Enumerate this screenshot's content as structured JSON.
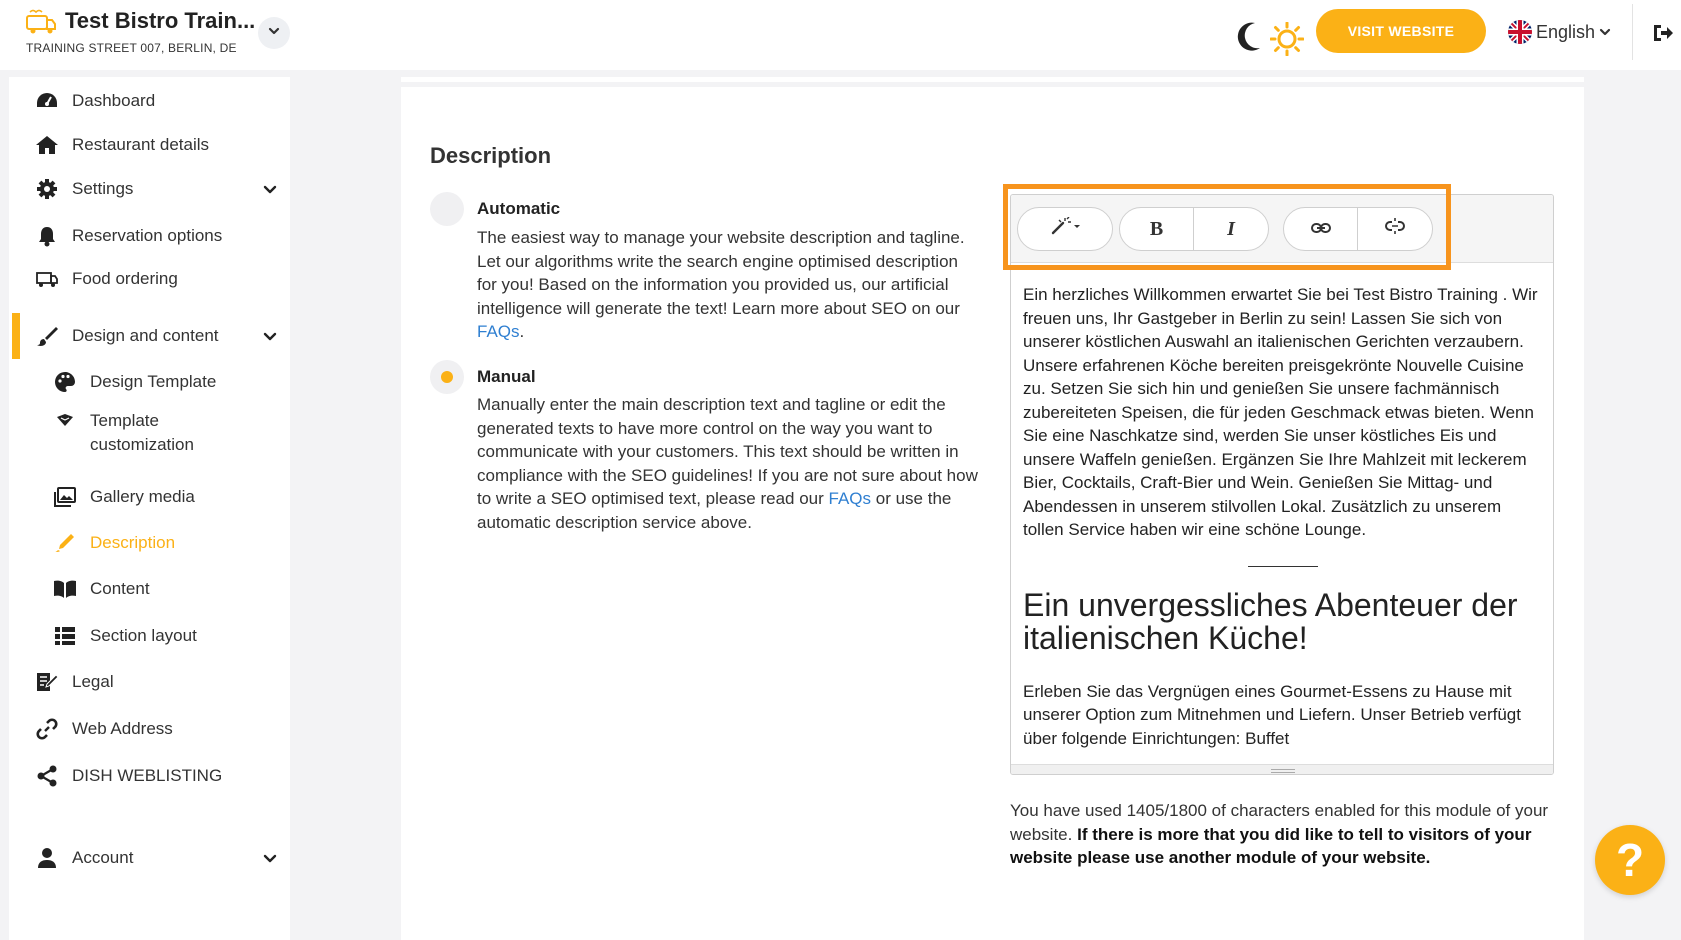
{
  "header": {
    "restaurant_name": "Test Bistro Train...",
    "address": "TRAINING STREET 007, BERLIN, DE",
    "visit_website_label": "VISIT WEBSITE",
    "language": "English",
    "accent_color": "#fbb116"
  },
  "sidebar": {
    "items": [
      {
        "label": "Dashboard",
        "icon": "dashboard-icon"
      },
      {
        "label": "Restaurant details",
        "icon": "home-icon"
      },
      {
        "label": "Settings",
        "icon": "gear-icon"
      },
      {
        "label": "Reservation options",
        "icon": "bell-icon"
      },
      {
        "label": "Food ordering",
        "icon": "delivery-icon"
      },
      {
        "label": "Design and content",
        "icon": "brush-icon"
      },
      {
        "label": "Design Template",
        "icon": "palette-icon"
      },
      {
        "label": "Template customization",
        "icon": "template-icon"
      },
      {
        "label": "Gallery media",
        "icon": "image-icon"
      },
      {
        "label": "Description",
        "icon": "pen-icon"
      },
      {
        "label": "Content",
        "icon": "book-icon"
      },
      {
        "label": "Section layout",
        "icon": "list-icon"
      },
      {
        "label": "Legal",
        "icon": "document-icon"
      },
      {
        "label": "Web Address",
        "icon": "link-icon"
      },
      {
        "label": "DISH WEBLISTING",
        "icon": "share-icon"
      },
      {
        "label": "Account",
        "icon": "user-icon"
      }
    ]
  },
  "main": {
    "title": "Description",
    "options": [
      {
        "title": "Automatic",
        "text_before_link": "The easiest way to manage your website description and tagline. Let our algorithms write the search engine optimised description for you! Based on the information you provided us, our artificial intelligence will generate the text! Learn more about SEO on our ",
        "link": "FAQs",
        "text_after_link": "."
      },
      {
        "title": "Manual",
        "text_before_link": "Manually enter the main description text and tagline or edit the generated texts to have more control on the way you want to communicate with your customers. This text should be written in compliance with the SEO guidelines! If you are not sure about how to write a SEO optimised text, please read our ",
        "link": "FAQs",
        "text_after_link": " or use the automatic description service above."
      }
    ],
    "selected_option": "Manual",
    "editor": {
      "toolbar": {
        "bold": "B",
        "italic": "I"
      },
      "paragraph1": "Ein herzliches Willkommen erwartet Sie bei Test Bistro Training . Wir freuen uns, Ihr Gastgeber in Berlin zu sein! Lassen Sie sich von unserer köstlichen Auswahl an italienischen Gerichten verzaubern. Unsere erfahrenen Köche bereiten preisgekrönte Nouvelle Cuisine zu. Setzen Sie sich hin und genießen Sie unsere fachmännisch zubereiteten Speisen, die für jeden Geschmack etwas bieten. Wenn Sie eine Naschkatze sind, werden Sie unser köstliches Eis und unsere Waffeln genießen. Ergänzen Sie Ihre Mahlzeit mit leckerem Bier, Cocktails, Craft-Bier und Wein. Genießen Sie Mittag- und Abendessen in unserem stilvollen Lokal. Zusätzlich zu unserem tollen Service haben wir eine schöne Lounge.",
      "heading": "Ein unvergessliches Abenteuer der italienischen Küche!",
      "paragraph2": "Erleben Sie das Vergnügen eines Gourmet-Essens zu Hause mit unserer Option zum Mitnehmen und Liefern. Unser Betrieb verfügt über folgende Einrichtungen: Buffet"
    },
    "usage_text": "You have used 1405/1800 of characters enabled for this module of your website. ",
    "usage_bold": "If there is more that you did like to tell to visitors of your website please use another module of your website."
  },
  "help": {
    "label": "?"
  }
}
